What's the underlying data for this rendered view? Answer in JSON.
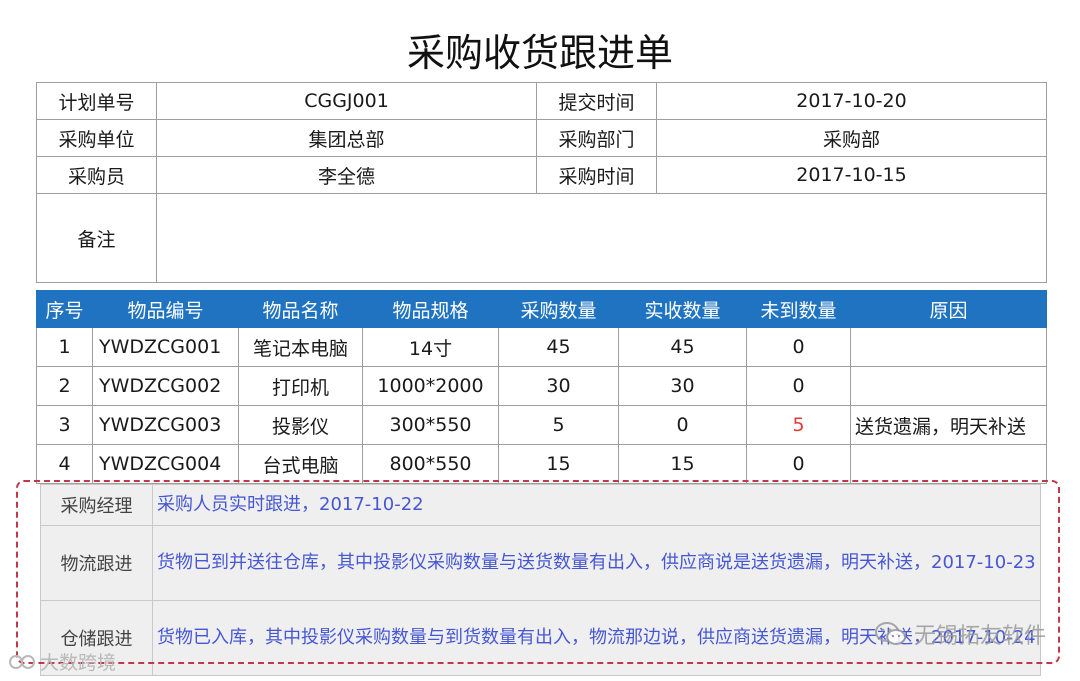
{
  "title": "采购收货跟进单",
  "info": {
    "plan_no_label": "计划单号",
    "plan_no": "CGGJ001",
    "submit_time_label": "提交时间",
    "submit_time": "2017-10-20",
    "unit_label": "采购单位",
    "unit": "集团总部",
    "dept_label": "采购部门",
    "dept": "采购部",
    "buyer_label": "采购员",
    "buyer": "李全德",
    "purchase_time_label": "采购时间",
    "purchase_time": "2017-10-15",
    "remark_label": "备注",
    "remark": ""
  },
  "items": {
    "headers": [
      "序号",
      "物品编号",
      "物品名称",
      "物品规格",
      "采购数量",
      "实收数量",
      "未到数量",
      "原因"
    ],
    "rows": [
      [
        "1",
        "YWDZCG001",
        "笔记本电脑",
        "14寸",
        "45",
        "45",
        "0",
        ""
      ],
      [
        "2",
        "YWDZCG002",
        "打印机",
        "1000*2000",
        "30",
        "30",
        "0",
        ""
      ],
      [
        "3",
        "YWDZCG003",
        "投影仪",
        "300*550",
        "5",
        "0",
        "5",
        "送货遗漏，明天补送"
      ],
      [
        "4",
        "YWDZCG004",
        "台式电脑",
        "800*550",
        "15",
        "15",
        "0",
        ""
      ]
    ]
  },
  "tracking": [
    {
      "label": "采购经理",
      "text": "采购人员实时跟进，2017-10-22"
    },
    {
      "label": "物流跟进",
      "text": "货物已到并送往仓库，其中投影仪采购数量与送货数量有出入，供应商说是送货遗漏，明天补送，2017-10-23"
    },
    {
      "label": "仓储跟进",
      "text": "货物已入库，其中投影仪采购数量与到货数量有出入，物流那边说，供应商送货遗漏，明天补送，2017-10-24"
    }
  ],
  "colors": {
    "header_bg": "#1f73c1",
    "alert": "#e53935",
    "tracking_text": "#4657d6",
    "dash_border": "#c0394b"
  },
  "watermarks": {
    "right": "无锡拓友软件",
    "left": "大数跨境",
    "right_icon": "wechat-icon",
    "left_icon": "mini-program-icon"
  }
}
